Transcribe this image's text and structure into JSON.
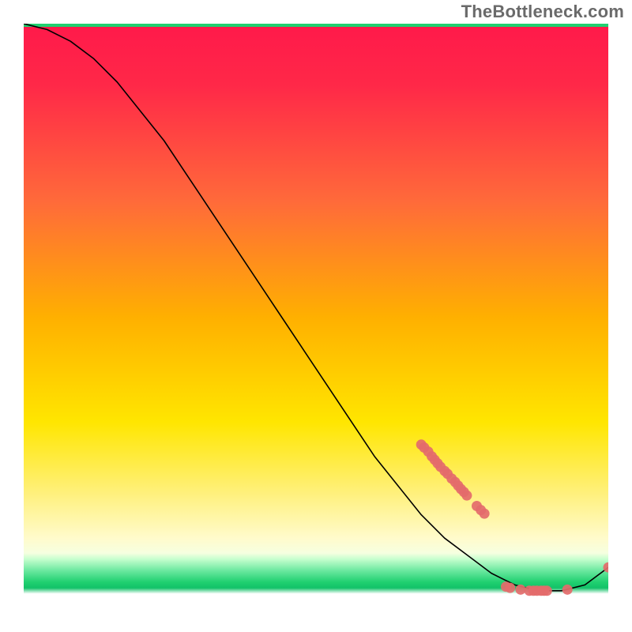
{
  "watermark": "TheBottleneck.com",
  "colors": {
    "curve": "#000000",
    "points": "#e46b6b",
    "top_band": "#20d070",
    "gradient_top": "#ff1a4a",
    "gradient_mid": "#ffd800",
    "gradient_bot_band_top": "#fff9c4",
    "white": "#ffffff"
  },
  "chart_data": {
    "type": "line",
    "title": "",
    "xlabel": "",
    "ylabel": "",
    "xlim": [
      0,
      100
    ],
    "ylim": [
      0,
      100
    ],
    "grid": false,
    "curve": {
      "x": [
        0,
        4,
        8,
        12,
        16,
        20,
        24,
        28,
        32,
        36,
        40,
        44,
        48,
        52,
        56,
        60,
        64,
        68,
        72,
        76,
        80,
        84,
        88,
        92,
        96,
        100
      ],
      "values": [
        100,
        99,
        97,
        94,
        90,
        85,
        80,
        74,
        68,
        62,
        56,
        50,
        44,
        38,
        32,
        26,
        21,
        16,
        12,
        9,
        6,
        4,
        3,
        3,
        4,
        7
      ]
    },
    "series": [
      {
        "name": "upper-cluster",
        "x": [
          68,
          68.5,
          69.2,
          69.8,
          70.3,
          70.8,
          71.3,
          72.0,
          72.5,
          73.2,
          73.8,
          74.3,
          74.8,
          75.3,
          75.8,
          77.5,
          78.2,
          78.8
        ],
        "values": [
          28,
          27.5,
          26.8,
          26.0,
          25.4,
          24.8,
          24.2,
          23.5,
          23.0,
          22.2,
          21.6,
          21.0,
          20.4,
          19.9,
          19.3,
          17.5,
          16.8,
          16.2
        ]
      },
      {
        "name": "lower-cluster",
        "x": [
          82.5,
          83.2,
          85.0,
          86.5,
          87.2,
          87.8,
          88.5,
          89.0,
          89.5,
          93.0,
          100.0
        ],
        "values": [
          3.7,
          3.5,
          3.2,
          3.0,
          3.0,
          3.0,
          3.0,
          3.0,
          3.0,
          3.2,
          7.0
        ]
      }
    ],
    "legend": {
      "visible": false
    }
  }
}
